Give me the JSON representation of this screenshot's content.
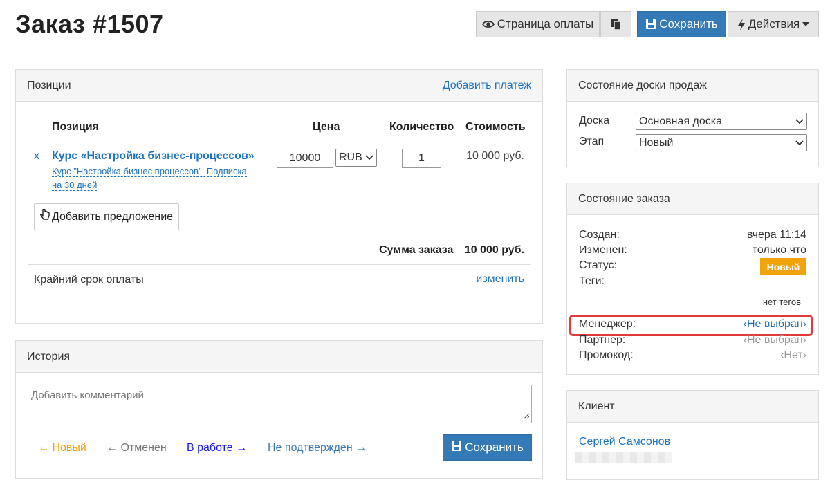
{
  "header": {
    "title": "Заказ #1507",
    "pay_page_label": "Страница оплаты",
    "save_label": "Сохранить",
    "actions_label": "Действия"
  },
  "positions": {
    "heading": "Позиции",
    "add_payment": "Добавить платеж",
    "columns": [
      "Позиция",
      "Цена",
      "Количество",
      "Стоимость"
    ],
    "item": {
      "remove": "x",
      "name": "Курс «Настройка бизнес-процессов»",
      "offer_line1": "Курс \"Настройка бизнес процессов\", Подписка",
      "offer_line2": "на 30 дней",
      "price": "10000",
      "currency": "RUB",
      "quantity": "1",
      "cost": "10 000 руб."
    },
    "add_offer": "Добавить предложение",
    "sum_label": "Сумма заказа",
    "sum_value": "10 000 руб.",
    "deadline_label": "Крайний срок оплаты",
    "deadline_change": "изменить"
  },
  "history": {
    "heading": "История",
    "comment_placeholder": "Добавить комментарий",
    "status_links": [
      "← Новый",
      "← Отменен",
      "В работе →",
      "Не подтвержден →"
    ],
    "save_label": "Сохранить"
  },
  "board": {
    "heading": "Состояние доски продаж",
    "board_label": "Доска",
    "board_value": "Основная доска",
    "stage_label": "Этап",
    "stage_value": "Новый"
  },
  "order_state": {
    "heading": "Состояние заказа",
    "created_label": "Создан:",
    "created_value": "вчера 11:14",
    "modified_label": "Изменен:",
    "modified_value": "только что",
    "status_label": "Статус:",
    "status_value": "Новый",
    "tags_label": "Теги:",
    "tags_value": "нет тегов",
    "manager_label": "Менеджер:",
    "manager_value": "Не выбран",
    "partner_label": "Партнер:",
    "partner_value": "Не выбран",
    "promo_label": "Промокод:",
    "promo_value": "Нет"
  },
  "client": {
    "heading": "Клиент",
    "name": "Сергей Самсонов"
  },
  "colors": {
    "primary": "#337ab7",
    "link": "#1e73be",
    "status_badge": "#f0a30a",
    "highlight": "#e03a3a",
    "new_link": "#f0a30a",
    "in_work_link": "#1a1ae6"
  }
}
